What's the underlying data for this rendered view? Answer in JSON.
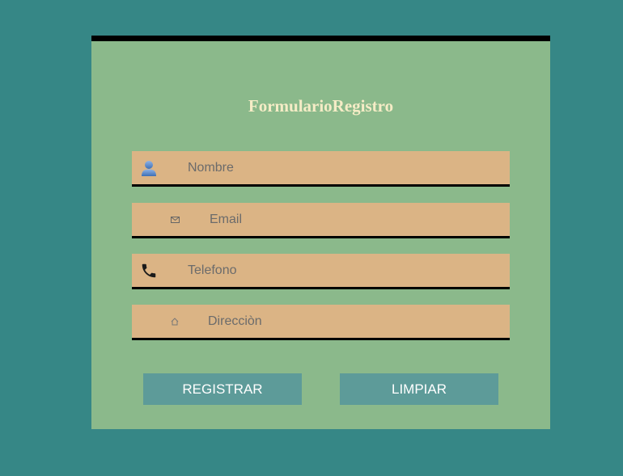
{
  "form": {
    "title": "FormularioRegistro",
    "fields": [
      {
        "icon": "user-icon",
        "placeholder": "Nombre"
      },
      {
        "icon": "envelope-icon",
        "placeholder": "Email"
      },
      {
        "icon": "phone-icon",
        "placeholder": "Telefono"
      },
      {
        "icon": "home-icon",
        "placeholder": "Direcciòn"
      }
    ],
    "buttons": {
      "register_label": "REGISTRAR",
      "clear_label": "LIMPIAR"
    }
  },
  "colors": {
    "background": "#368786",
    "card": "#8bb98b",
    "field": "#dbb485",
    "button": "#5d9b99",
    "title": "#f5ecc6"
  }
}
